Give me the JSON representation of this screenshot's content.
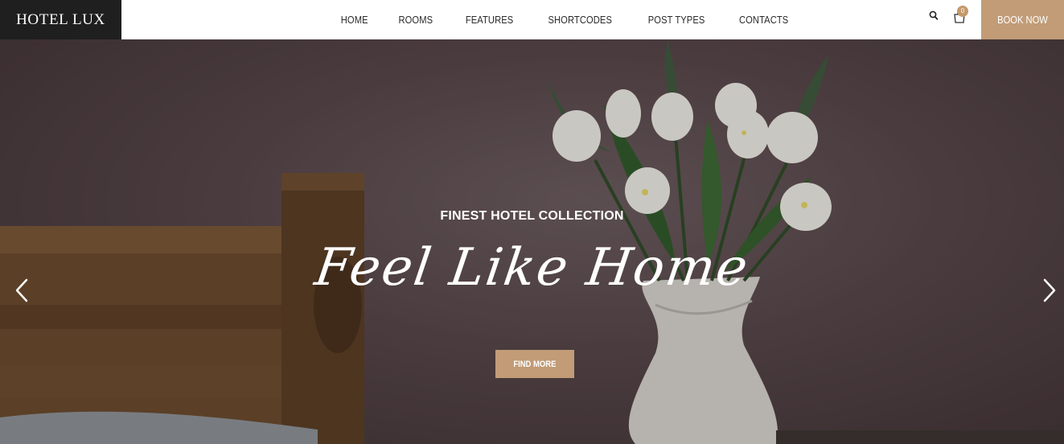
{
  "header": {
    "logo": "HOTEL LUX",
    "nav": [
      "HOME",
      "ROOMS",
      "FEATURES",
      "SHORTCODES",
      "POST TYPES",
      "CONTACTS"
    ],
    "cart_count": "0",
    "book_label": "BOOK NOW"
  },
  "hero": {
    "subtitle": "FINEST HOTEL COLLECTION",
    "title": "Feel Like Home",
    "button": "FIND MORE"
  },
  "icons": {
    "search": "search-icon",
    "cart": "cart-icon",
    "prev": "chevron-left-icon",
    "next": "chevron-right-icon"
  },
  "colors": {
    "accent": "#c19c77",
    "logo_bg": "#1f1f1f",
    "nav_text": "#2a2a2a"
  }
}
